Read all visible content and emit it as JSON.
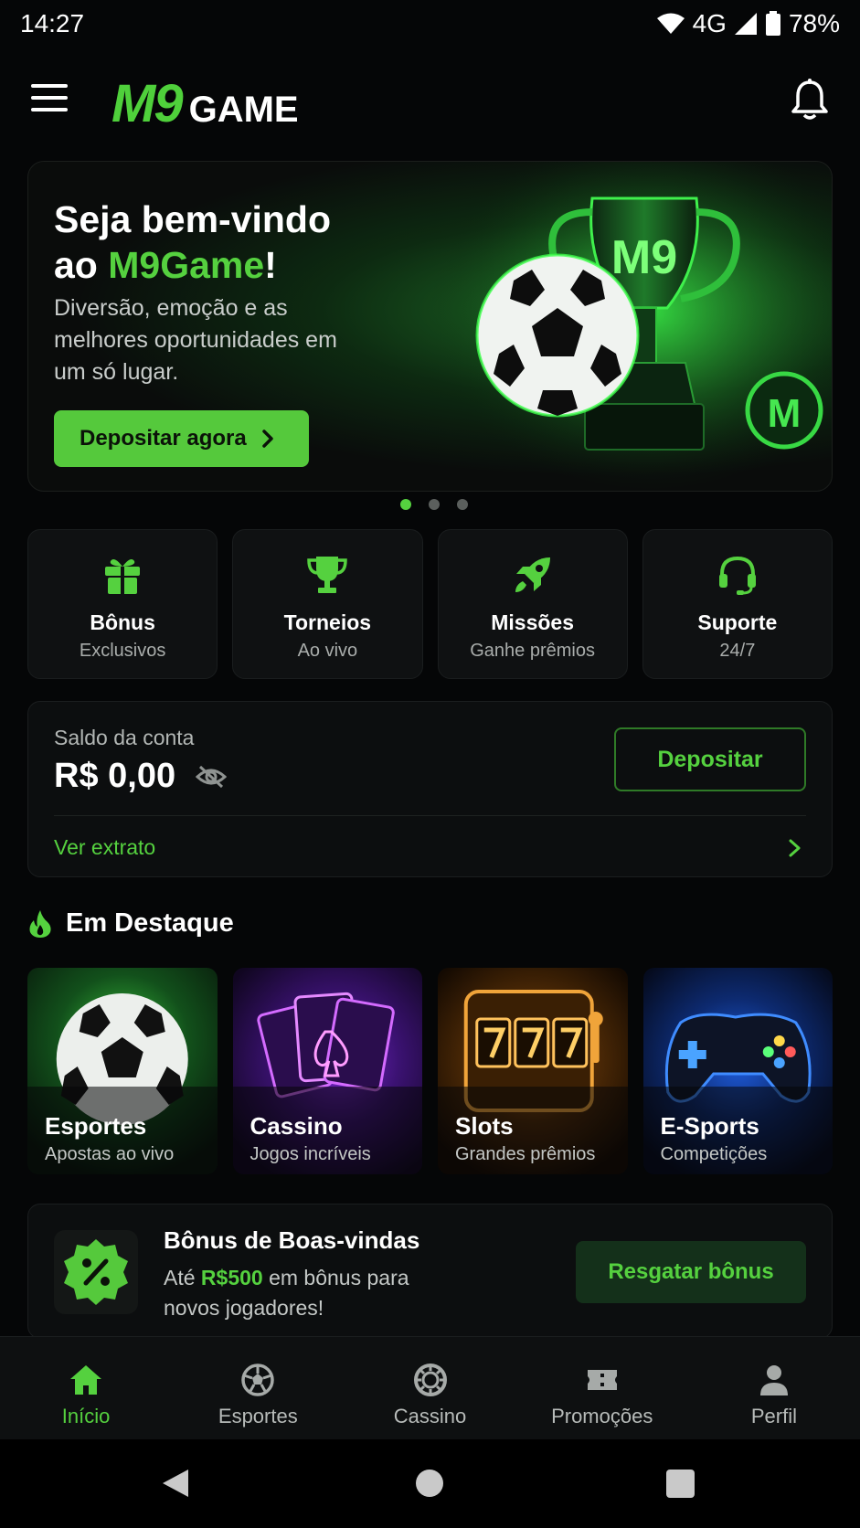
{
  "status_bar": {
    "time": "14:27",
    "network": "4G",
    "battery": "78%"
  },
  "header": {
    "logo_mark": "M9",
    "logo_word": "GAME"
  },
  "hero": {
    "title_line1": "Seja bem-vindo",
    "title_prefix": "ao ",
    "title_highlight": "M9Game",
    "title_suffix": "!",
    "subtitle": "Diversão, emoção e as melhores oportunidades em um só lugar.",
    "cta_label": "Depositar agora",
    "trophy_text": "M9",
    "coin_text": "M",
    "slides_total": 3,
    "slide_active": 1
  },
  "features": [
    {
      "title": "Bônus",
      "subtitle": "Exclusivos",
      "icon": "gift-icon"
    },
    {
      "title": "Torneios",
      "subtitle": "Ao vivo",
      "icon": "trophy-icon"
    },
    {
      "title": "Missões",
      "subtitle": "Ganhe prêmios",
      "icon": "rocket-icon"
    },
    {
      "title": "Suporte",
      "subtitle": "24/7",
      "icon": "headset-icon"
    }
  ],
  "balance": {
    "label": "Saldo da conta",
    "amount": "R$ 0,00",
    "deposit_label": "Depositar",
    "statement_label": "Ver extrato"
  },
  "highlights": {
    "title": "Em Destaque",
    "cards": [
      {
        "title": "Esportes",
        "subtitle": "Apostas ao vivo"
      },
      {
        "title": "Cassino",
        "subtitle": "Jogos incríveis"
      },
      {
        "title": "Slots",
        "subtitle": "Grandes prêmios"
      },
      {
        "title": "E-Sports",
        "subtitle": "Competições"
      }
    ]
  },
  "welcome_bonus": {
    "title": "Bônus de Boas-vindas",
    "text_prefix": "Até ",
    "text_amount": "R$500",
    "text_suffix": " em bônus para novos jogadores!",
    "cta_label": "Resgatar bônus"
  },
  "bottom_nav": [
    {
      "label": "Início",
      "active": true
    },
    {
      "label": "Esportes",
      "active": false
    },
    {
      "label": "Cassino",
      "active": false
    },
    {
      "label": "Promoções",
      "active": false
    },
    {
      "label": "Perfil",
      "active": false
    }
  ],
  "colors": {
    "accent": "#55d13f",
    "background": "#050607",
    "card": "#0f1112"
  }
}
